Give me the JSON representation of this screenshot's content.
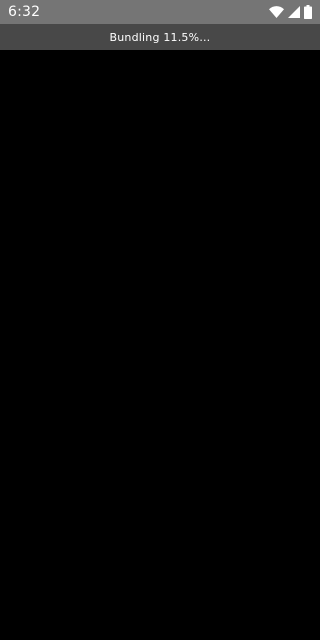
{
  "status_bar": {
    "time": "6:32",
    "icons": [
      "wifi-icon",
      "cellular-signal-icon",
      "battery-icon"
    ],
    "background": "#757575"
  },
  "banner": {
    "text": "Bundling 11.5%…",
    "progress_percent": 11.5,
    "background": "#484848"
  },
  "app": {
    "background": "#000000"
  }
}
